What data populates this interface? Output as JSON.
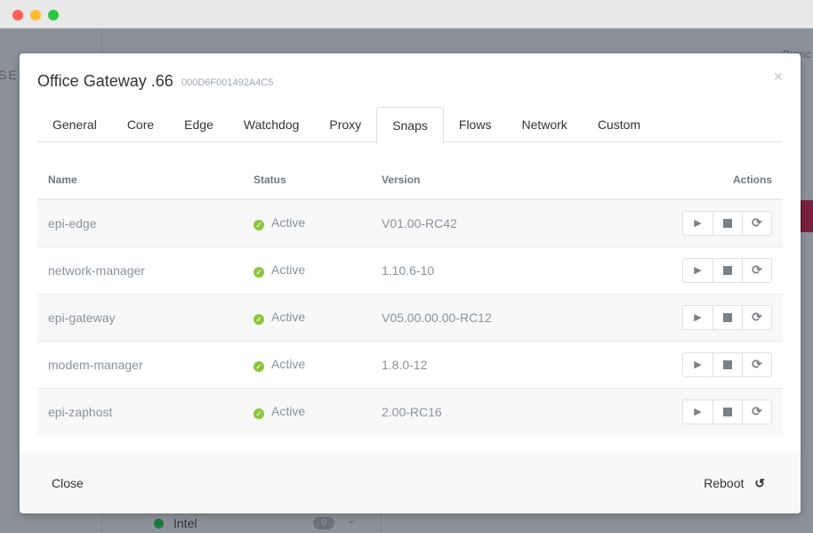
{
  "window": {
    "controls": {
      "close": "#fe5f57",
      "minimize": "#febc2e",
      "maximize": "#28c840"
    }
  },
  "background": {
    "left_text": "SEN",
    "right_text": "Branc",
    "list_item": "Intel",
    "list_badge": "0",
    "accent_color": "#7a1f3f"
  },
  "modal": {
    "title": "Office Gateway .66",
    "serial": "000D6F001492A4C5",
    "close_icon": "×",
    "tabs": [
      {
        "label": "General"
      },
      {
        "label": "Core"
      },
      {
        "label": "Edge"
      },
      {
        "label": "Watchdog"
      },
      {
        "label": "Proxy"
      },
      {
        "label": "Snaps",
        "active": true
      },
      {
        "label": "Flows"
      },
      {
        "label": "Network"
      },
      {
        "label": "Custom"
      }
    ],
    "table": {
      "headers": [
        "Name",
        "Status",
        "Version",
        "Actions"
      ],
      "rows": [
        {
          "name": "epi-edge",
          "status": "Active",
          "version": "V01.00-RC42"
        },
        {
          "name": "network-manager",
          "status": "Active",
          "version": "1.10.6-10"
        },
        {
          "name": "epi-gateway",
          "status": "Active",
          "version": "V05.00.00.00-RC12"
        },
        {
          "name": "modem-manager",
          "status": "Active",
          "version": "1.8.0-12"
        },
        {
          "name": "epi-zaphost",
          "status": "Active",
          "version": "2.00-RC16"
        }
      ],
      "status_color": "#8dc63f"
    },
    "footer": {
      "close_label": "Close",
      "reboot_label": "Reboot"
    }
  }
}
